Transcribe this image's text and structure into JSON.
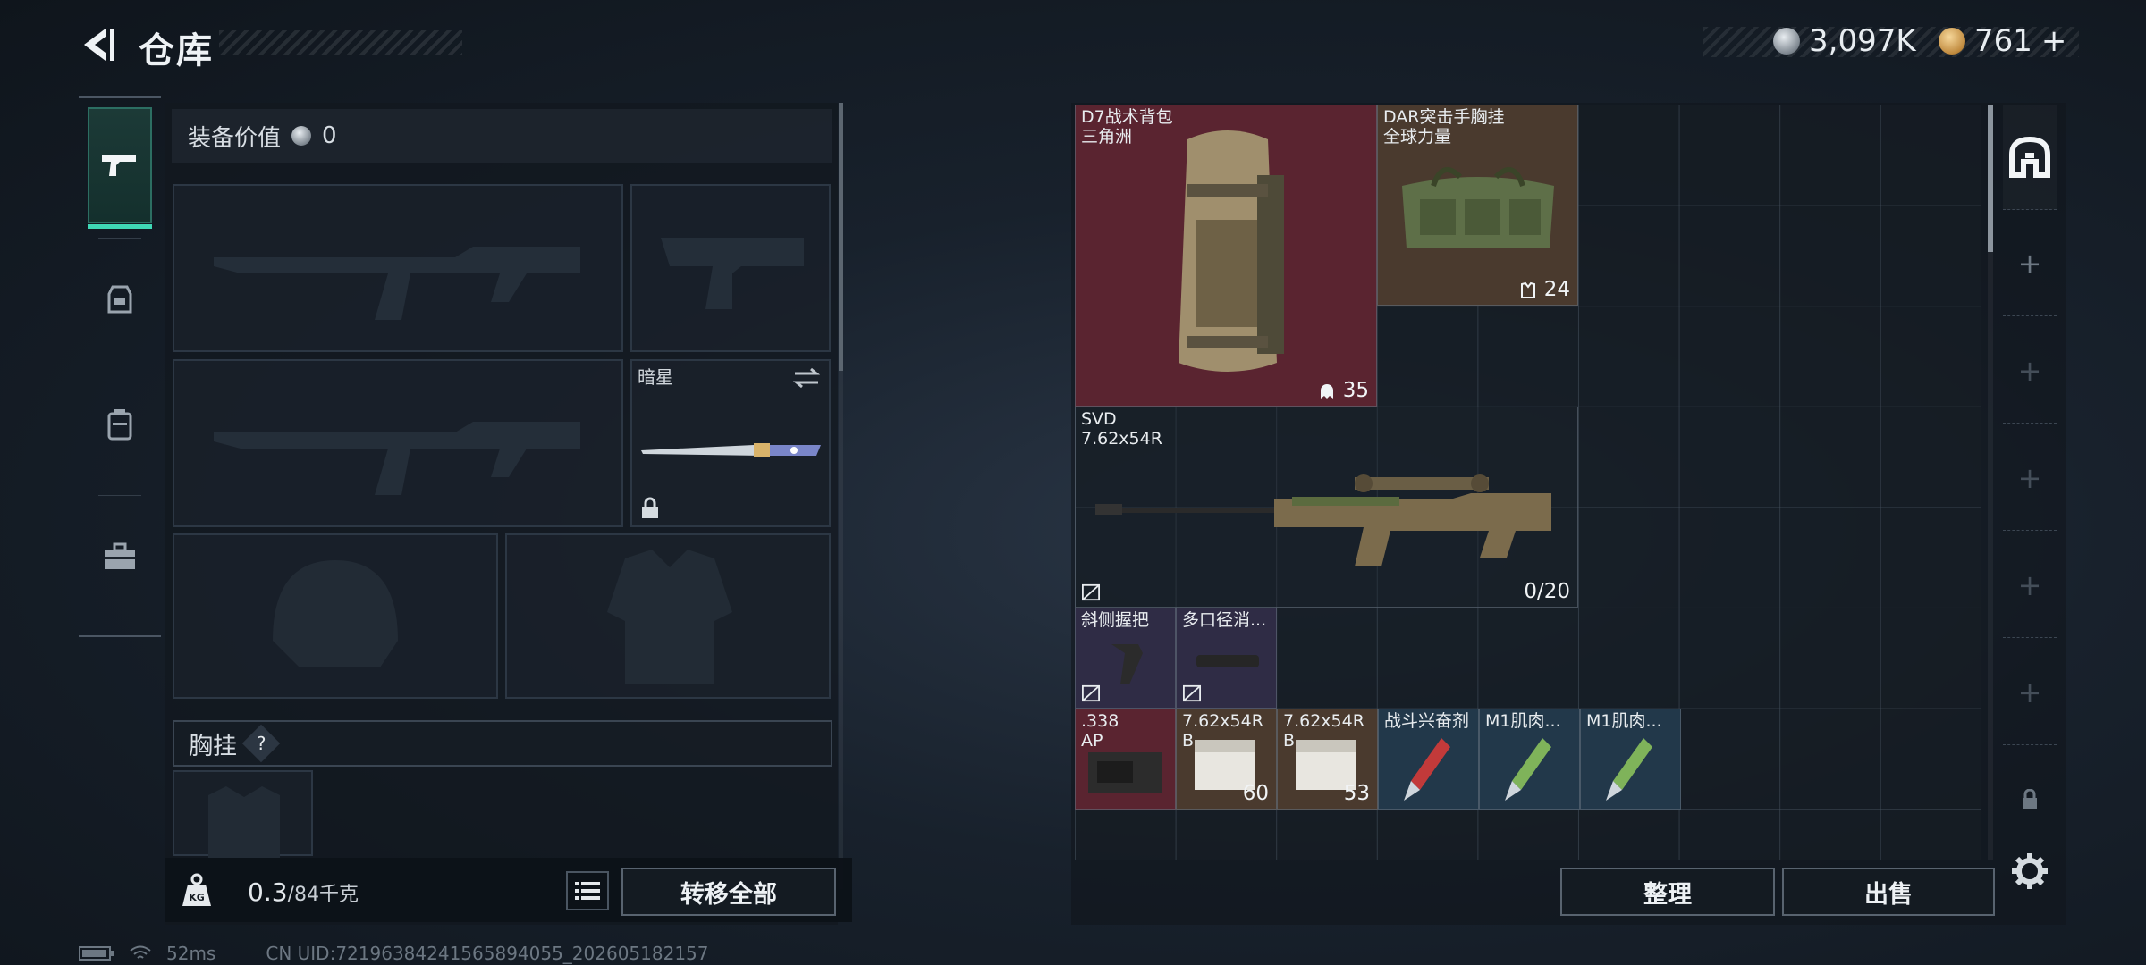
{
  "header": {
    "title": "仓库",
    "currency_primary": "3,097K",
    "currency_secondary": "761",
    "currency_add": "+"
  },
  "sidebar": {
    "categories": [
      {
        "name": "weapons",
        "icon": "pistol-icon",
        "active": true
      },
      {
        "name": "armor",
        "icon": "armor-bag-icon",
        "active": false
      },
      {
        "name": "backpack",
        "icon": "backpack-icon",
        "active": false
      },
      {
        "name": "toolbox",
        "icon": "toolbox-icon",
        "active": false
      }
    ]
  },
  "equipment": {
    "value_label": "装备价值",
    "value": "0",
    "knife_label": "暗星",
    "chest_label": "胸挂",
    "chest_help": "?"
  },
  "weight": {
    "current": "0.3",
    "max": "/84千克"
  },
  "buttons": {
    "transfer_all": "转移全部",
    "sort": "整理",
    "sell": "出售"
  },
  "status": {
    "ping": "52ms",
    "uid": "CN UID:72196384241565894055_202605182157"
  },
  "stash": {
    "items": [
      {
        "id": "d7-backpack",
        "line1": "D7战术背包",
        "line2": "三角洲",
        "count": "35",
        "count_icon": "ghost-icon"
      },
      {
        "id": "dar-rig",
        "line1": "DAR突击手胸挂",
        "line2": "全球力量",
        "count": "24",
        "count_icon": "vest-icon"
      },
      {
        "id": "svd",
        "line1": "SVD",
        "line2": "7.62x54R",
        "count": "0/20"
      },
      {
        "id": "grip",
        "line1": "斜侧握把",
        "line2": ""
      },
      {
        "id": "suppressor",
        "line1": "多口径消...",
        "line2": ""
      },
      {
        "id": "ammo-338",
        "line1": ".338",
        "line2": "AP"
      },
      {
        "id": "ammo-762-a",
        "line1": "7.62x54R",
        "line2": "B",
        "count": "60"
      },
      {
        "id": "ammo-762-b",
        "line1": "7.62x54R",
        "line2": "B",
        "count": "53"
      },
      {
        "id": "stim",
        "line1": "战斗兴奋剂",
        "line2": ""
      },
      {
        "id": "m1-a",
        "line1": "M1肌肉...",
        "line2": ""
      },
      {
        "id": "m1-b",
        "line1": "M1肌肉...",
        "line2": ""
      }
    ]
  },
  "colors": {
    "accent": "#3fd8b6",
    "item_red": "#5a2430",
    "item_brown": "#4a3a2e",
    "item_purple": "#2f2c45",
    "item_blue": "#22384a"
  }
}
